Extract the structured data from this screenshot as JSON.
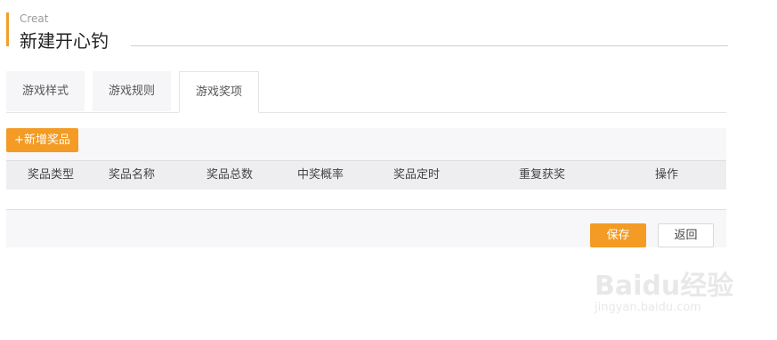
{
  "header": {
    "subtitle": "Creat",
    "title": "新建开心钓"
  },
  "tabs": [
    {
      "label": "游戏样式",
      "active": false
    },
    {
      "label": "游戏规则",
      "active": false
    },
    {
      "label": "游戏奖项",
      "active": true
    }
  ],
  "toolbar": {
    "add_label": "+新增奖品"
  },
  "table": {
    "columns": [
      "奖品类型",
      "奖品名称",
      "奖品总数",
      "中奖概率",
      "奖品定时",
      "重复获奖",
      "操作"
    ]
  },
  "actions": {
    "save_label": "保存",
    "back_label": "返回"
  },
  "watermark": {
    "brand": "Baidu经验",
    "url": "jingyan.baidu.com"
  },
  "colors": {
    "accent": "#f39b24",
    "header_bar": "#f0a02a"
  }
}
